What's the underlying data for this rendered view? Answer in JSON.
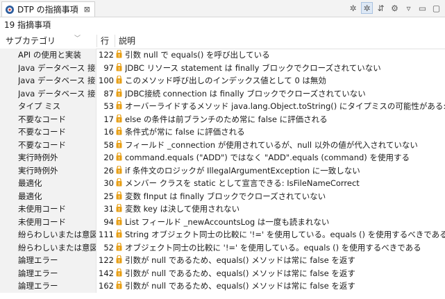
{
  "tab": {
    "title": "DTP の指摘事項",
    "close_glyph": "⊠"
  },
  "toolbar": {
    "icons": [
      "filter-error-icon",
      "filter-warning-icon",
      "group-by-icon",
      "collapse-icon",
      "view-menu-icon",
      "minimize-icon",
      "maximize-icon"
    ],
    "glyphs": [
      "✲",
      "✲",
      "⇵",
      "⚙",
      "▿",
      "▭",
      "▢"
    ]
  },
  "summary": "19 指摘事項",
  "columns": {
    "category": "サブカテゴリ",
    "line": "行",
    "description": "説明"
  },
  "colors": {
    "warning": "#e8a11a",
    "row_bg": "#f2f2f2",
    "active_tool": "#dde8f5"
  },
  "rows": [
    {
      "category": "API の使用と実装",
      "line": "122",
      "description": "引数 null で equals() を呼び出している"
    },
    {
      "category": "Java データベース 接続",
      "line": "97",
      "description": "JDBC リソース statement は finally ブロックでクローズされていない"
    },
    {
      "category": "Java データベース 接続",
      "line": "100",
      "description": "このメソッド呼び出しのインデックス値として 0 は無効"
    },
    {
      "category": "Java データベース 接続",
      "line": "87",
      "description": "JDBC接続 connection は finally ブロックでクローズされていない"
    },
    {
      "category": "タイプ ミス",
      "line": "53",
      "description": "オーバーライドするメソッド java.lang.Object.toString() にタイプミスの可能性がある: toStrng() は t"
    },
    {
      "category": "不要なコード",
      "line": "17",
      "description": "else の条件は前ブランチのため常に false に評価される"
    },
    {
      "category": "不要なコード",
      "line": "16",
      "description": "条件式が常に false に評価される"
    },
    {
      "category": "不要なコード",
      "line": "58",
      "description": "フィールド _connection が使用されているが、null 以外の値が代入されていない"
    },
    {
      "category": "実行時例外",
      "line": "20",
      "description": "command.equals (\"ADD\") ではなく \"ADD\".equals (command) を使用する"
    },
    {
      "category": "実行時例外",
      "line": "26",
      "description": "if 条件文のロジックが IllegalArgumentException に一致しない"
    },
    {
      "category": "最適化",
      "line": "30",
      "description": "メンバー クラスを static として宣言できる: IsFileNameCorrect"
    },
    {
      "category": "最適化",
      "line": "25",
      "description": "変数 fInput は finally ブロックでクローズされていない"
    },
    {
      "category": "未使用コード",
      "line": "31",
      "description": "変数 key は決して使用されない"
    },
    {
      "category": "未使用コード",
      "line": "94",
      "description": "List フィールド _newAccountsLog は一度も読まれない"
    },
    {
      "category": "紛らわしいまたは意図的",
      "line": "111",
      "description": "String オブジェクト同士の比較に '!=' を使用している。equals () を使用するべきである"
    },
    {
      "category": "紛らわしいまたは意図的",
      "line": "52",
      "description": "オブジェクト同士の比較に '!=' を使用している。equals () を使用するべきである"
    },
    {
      "category": "論理エラー",
      "line": "122",
      "description": "引数が null であるため、equals() メソッドは常に false を返す"
    },
    {
      "category": "論理エラー",
      "line": "142",
      "description": "引数が null であるため、equals() メソッドは常に false を返す"
    },
    {
      "category": "論理エラー",
      "line": "162",
      "description": "引数が null であるため、equals() メソッドは常に false を返す"
    }
  ]
}
